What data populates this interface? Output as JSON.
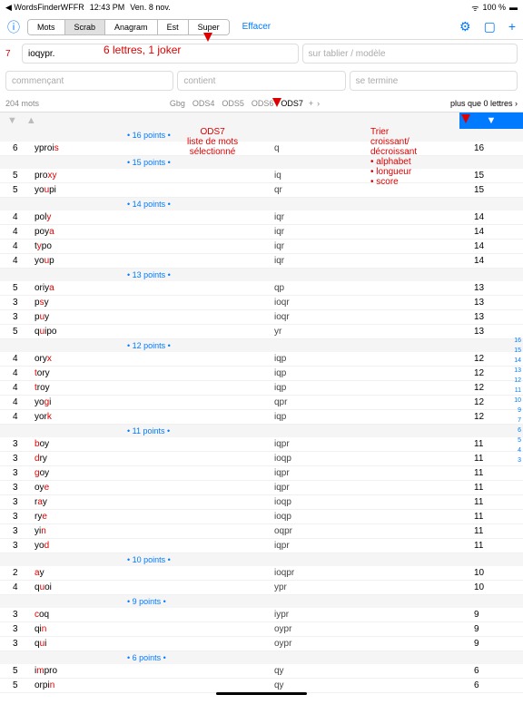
{
  "status": {
    "back": "◀ WordsFinderWFFR",
    "time": "12:43 PM",
    "date": "Ven. 8 nov.",
    "wifi": "᯾",
    "batt": "100 %",
    "batt_icon": "▮"
  },
  "toolbar": {
    "info": "ⓘ",
    "tabs": [
      "Mots",
      "Scrab",
      "Anagram",
      "Est",
      "Super"
    ],
    "active": 1,
    "effacer": "Effacer",
    "icons": {
      "wrench": "🔧",
      "book": "▭",
      "plus": "+"
    }
  },
  "inputs": {
    "count": "7",
    "letters": "ioqypr.",
    "tablier_ph": "sur tablier / modèle",
    "commence_ph": "commençant",
    "contient_ph": "contient",
    "termine_ph": "se termine"
  },
  "dict": {
    "wordcount": "204 mots",
    "dicts": [
      "Gbg",
      "ODS4",
      "ODS5",
      "ODS6",
      "ODS7"
    ],
    "active": "ODS7",
    "plus": "+",
    "chev": "›",
    "plus_lettres": "plus que 0 lettres ›"
  },
  "sort": {
    "down": "▼",
    "up": "▲",
    "rdown": "▼"
  },
  "annotations": {
    "a1": "6 lettres, 1 joker",
    "a2": "ODS7\nliste de mots\nsélectionné",
    "a3": "Trier\ncroissant/\ndécroissant\n• alphabet\n• longueur\n• score"
  },
  "side": [
    "16",
    "15",
    "14",
    "13",
    "12",
    "11",
    "10",
    "9",
    "7",
    "6",
    "5",
    "4",
    "3"
  ],
  "home": "",
  "groups": [
    {
      "pts": "• 16 points •",
      "rows": [
        {
          "s": "6",
          "w": "yproi",
          "h": "s",
          "p": "q",
          "pt": "16"
        }
      ]
    },
    {
      "pts": "• 15 points •",
      "rows": [
        {
          "s": "5",
          "w": "pro",
          "h": "xy",
          "p": "iq",
          "pt": "15",
          "hp": 1
        },
        {
          "s": "5",
          "w": "yo",
          "h": "u",
          "m": "pi",
          "p": "qr",
          "pt": "15"
        }
      ]
    },
    {
      "pts": "• 14 points •",
      "rows": [
        {
          "s": "4",
          "w": "pol",
          "h": "y",
          "p": "iqr",
          "pt": "14",
          "hp": 2
        },
        {
          "s": "4",
          "w": "poy",
          "h": "a",
          "p": "iqr",
          "pt": "14"
        },
        {
          "s": "4",
          "w": "t",
          "h": "y",
          "m": "po",
          "p": "iqr",
          "pt": "14",
          "hp": 0
        },
        {
          "s": "4",
          "w": "yo",
          "h": "u",
          "m": "p",
          "p": "iqr",
          "pt": "14"
        }
      ]
    },
    {
      "pts": "• 13 points •",
      "rows": [
        {
          "s": "5",
          "w": "oriy",
          "h": "a",
          "p": "qp",
          "pt": "13"
        },
        {
          "s": "3",
          "w": "p",
          "h": "s",
          "m": "y",
          "p": "ioqr",
          "pt": "13"
        },
        {
          "s": "3",
          "w": "p",
          "h": "u",
          "m": "y",
          "p": "ioqr",
          "pt": "13"
        },
        {
          "s": "5",
          "w": "q",
          "h": "u",
          "m": "ipo",
          "p": "yr",
          "pt": "13"
        }
      ]
    },
    {
      "pts": "• 12 points •",
      "rows": [
        {
          "s": "4",
          "w": "ory",
          "h": "x",
          "p": "iqp",
          "pt": "12"
        },
        {
          "s": "4",
          "w": "",
          "h": "t",
          "m": "ory",
          "p": "iqp",
          "pt": "12"
        },
        {
          "s": "4",
          "w": "",
          "h": "t",
          "m": "roy",
          "p": "iqp",
          "pt": "12"
        },
        {
          "s": "4",
          "w": "yo",
          "h": "g",
          "m": "i",
          "p": "qpr",
          "pt": "12"
        },
        {
          "s": "4",
          "w": "yor",
          "h": "k",
          "p": "iqp",
          "pt": "12"
        }
      ]
    },
    {
      "pts": "• 11 points •",
      "rows": [
        {
          "s": "3",
          "w": "",
          "h": "b",
          "m": "oy",
          "p": "iqpr",
          "pt": "11"
        },
        {
          "s": "3",
          "w": "",
          "h": "d",
          "m": "ry",
          "p": "ioqp",
          "pt": "11"
        },
        {
          "s": "3",
          "w": "",
          "h": "g",
          "m": "oy",
          "p": "iqpr",
          "pt": "11"
        },
        {
          "s": "3",
          "w": "oy",
          "h": "e",
          "p": "iqpr",
          "pt": "11"
        },
        {
          "s": "3",
          "w": "r",
          "h": "a",
          "m": "y",
          "p": "ioqp",
          "pt": "11"
        },
        {
          "s": "3",
          "w": "ry",
          "h": "e",
          "p": "ioqp",
          "pt": "11"
        },
        {
          "s": "3",
          "w": "yi",
          "h": "n",
          "p": "oqpr",
          "pt": "11"
        },
        {
          "s": "3",
          "w": "yo",
          "h": "d",
          "p": "iqpr",
          "pt": "11"
        }
      ]
    },
    {
      "pts": "• 10 points •",
      "rows": [
        {
          "s": "2",
          "w": "",
          "h": "a",
          "m": "y",
          "p": "ioqpr",
          "pt": "10"
        },
        {
          "s": "4",
          "w": "q",
          "h": "u",
          "m": "oi",
          "p": "ypr",
          "pt": "10"
        }
      ]
    },
    {
      "pts": "• 9 points •",
      "rows": [
        {
          "s": "3",
          "w": "",
          "h": "c",
          "m": "oq",
          "p": "iypr",
          "pt": "9"
        },
        {
          "s": "3",
          "w": "qi",
          "h": "n",
          "p": "oypr",
          "pt": "9"
        },
        {
          "s": "3",
          "w": "q",
          "h": "u",
          "m": "i",
          "p": "oypr",
          "pt": "9"
        }
      ]
    },
    {
      "pts": "• 6 points •",
      "rows": [
        {
          "s": "5",
          "w": "i",
          "h": "m",
          "m": "pro",
          "p": "qy",
          "pt": "6"
        },
        {
          "s": "5",
          "w": "orpi",
          "h": "n",
          "p": "qy",
          "pt": "6"
        }
      ]
    }
  ]
}
